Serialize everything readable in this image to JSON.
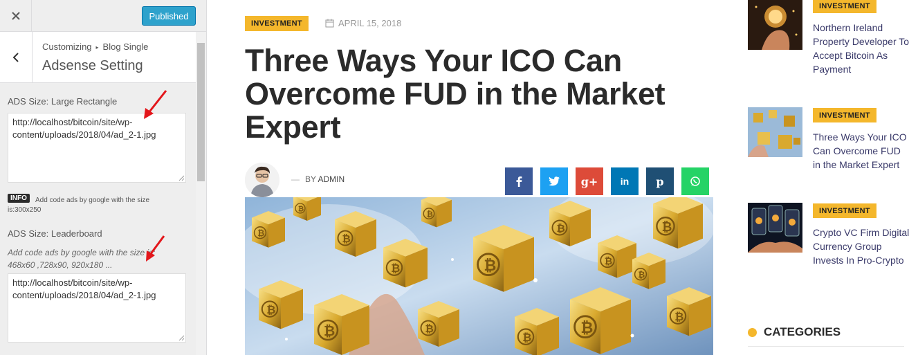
{
  "customizer": {
    "close_icon": "close-icon",
    "publish_label": "Published",
    "breadcrumb": {
      "parent": "Customizing",
      "child": "Blog Single"
    },
    "section_title": "Adsense Setting",
    "controls": [
      {
        "label": "ADS Size: Large Rectangle",
        "value_line1": "http://localhost/bitcoin/site/wp-",
        "value_line2": "content/uploads/2018/04/ad_2-1.jpg",
        "info_badge": "INFO",
        "info_text": "Add code ads by google with the size is:300x250"
      },
      {
        "label": "ADS Size: Leaderboard",
        "description": "Add code ads by google with the size is: 468x60 ,728x90, 920x180 ...",
        "value_line1": "http://localhost/bitcoin/site/wp-",
        "value_line2": "content/uploads/2018/04/ad_2-1.jpg"
      }
    ]
  },
  "post": {
    "category": "INVESTMENT",
    "date": "APRIL 15, 2018",
    "title": "Three Ways Your ICO Can Overcome FUD in the Market Expert",
    "byline_prefix": "BY",
    "author": "ADMIN",
    "share": [
      {
        "network": "facebook",
        "glyph": "f",
        "color": "#3b5998"
      },
      {
        "network": "twitter",
        "glyph": "t",
        "color": "#1da1f2"
      },
      {
        "network": "google-plus",
        "glyph": "g+",
        "color": "#dd4b39"
      },
      {
        "network": "linkedin",
        "glyph": "in",
        "color": "#0077b5"
      },
      {
        "network": "pinterest",
        "glyph": "p",
        "color": "#1f4f74"
      },
      {
        "network": "whatsapp",
        "glyph": "w",
        "color": "#25d366"
      }
    ]
  },
  "sidebar_widgets": {
    "recent_posts": [
      {
        "category": "INVESTMENT",
        "title": "Northern Ireland Property Developer To Accept Bitcoin As Payment"
      },
      {
        "category": "INVESTMENT",
        "title": "Three Ways Your ICO Can Overcome FUD in the Market Expert"
      },
      {
        "category": "INVESTMENT",
        "title": "Crypto VC Firm Digital Currency Group Invests In Pro-Crypto"
      }
    ],
    "categories_heading": "CATEGORIES"
  },
  "colors": {
    "accent": "#f4b72c",
    "publish": "#2ea2cc",
    "title_text": "#2b2b2b",
    "link_text": "#3a3a6a",
    "annotation_arrow": "#e3161b"
  }
}
